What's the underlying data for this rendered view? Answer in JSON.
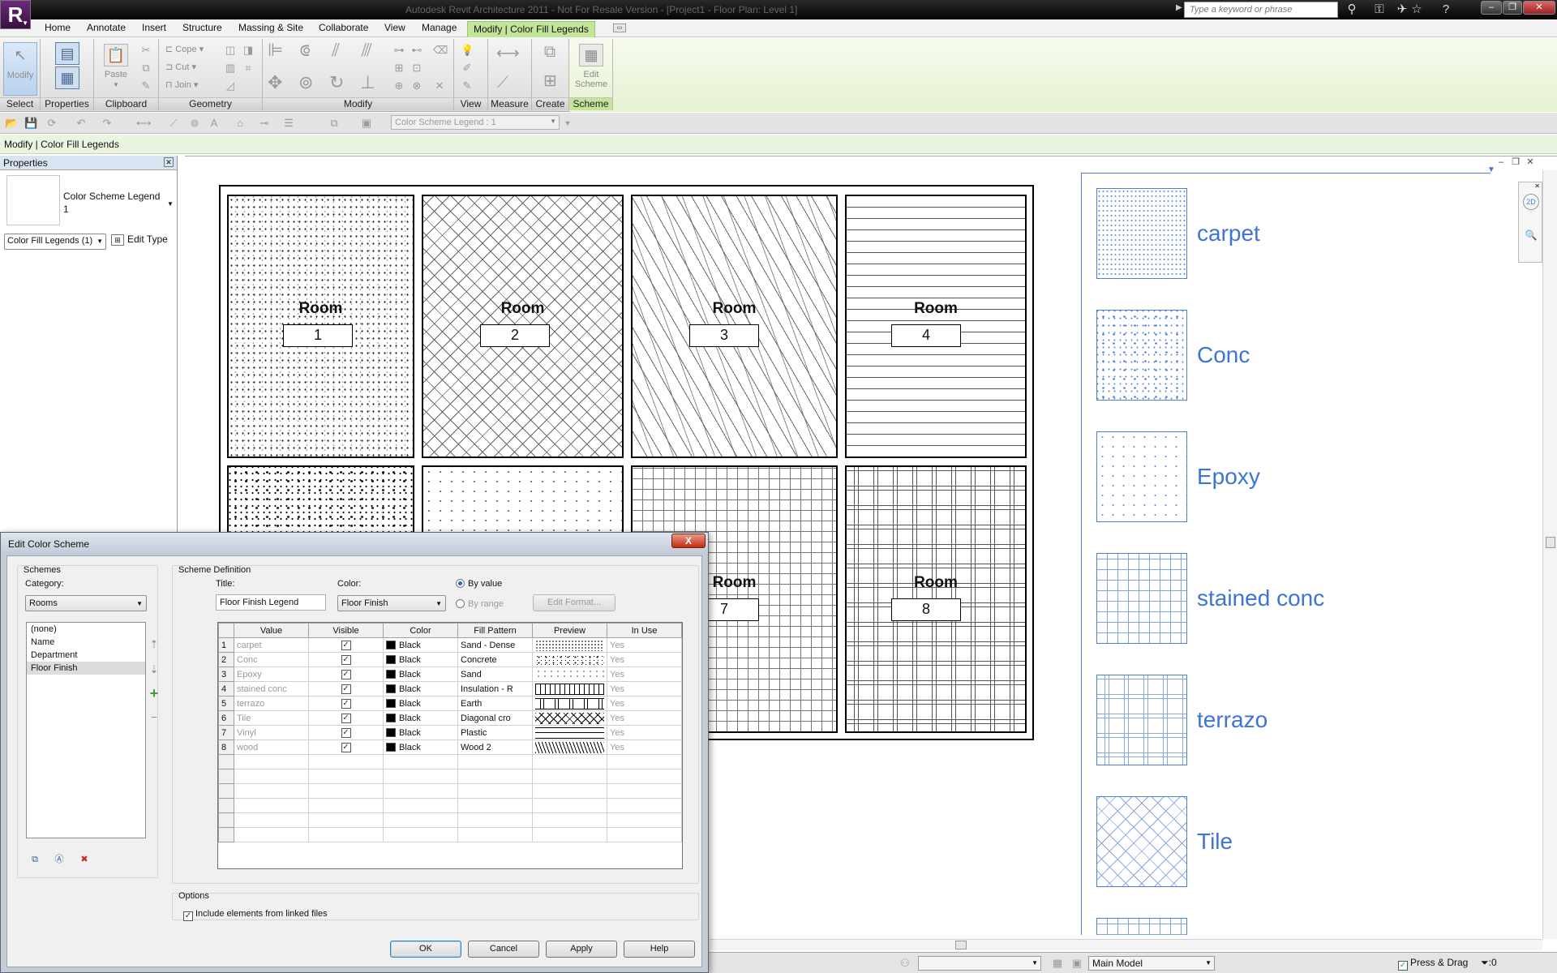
{
  "window": {
    "app_menu_letter": "R",
    "title": "Autodesk Revit Architecture 2011 - Not For Resale Version - [Project1 - Floor Plan: Level 1]",
    "search_placeholder": "Type a keyword or phrase"
  },
  "ribbon": {
    "tabs": [
      "Home",
      "Annotate",
      "Insert",
      "Structure",
      "Massing & Site",
      "Collaborate",
      "View",
      "Manage"
    ],
    "context_tab": "Modify | Color Fill Legends",
    "buttons": {
      "modify": "Modify",
      "paste": "Paste",
      "cope": "Cope",
      "cut": "Cut",
      "join": "Join",
      "edit_scheme_line1": "Edit",
      "edit_scheme_line2": "Scheme"
    },
    "panels": [
      "Select",
      "Properties",
      "Clipboard",
      "Geometry",
      "Modify",
      "View",
      "Measure",
      "Create",
      "Scheme"
    ]
  },
  "qat": {
    "type_selector": "Color Scheme Legend : 1"
  },
  "options_bar": {
    "text": "Modify | Color Fill Legends"
  },
  "properties": {
    "title": "Properties",
    "type_name_line1": "Color Scheme Legend",
    "type_name_line2": "1",
    "instance_selector": "Color Fill Legends (1)",
    "edit_type": "Edit Type"
  },
  "plan": {
    "rooms": [
      {
        "label": "Room",
        "number": "1",
        "pattern": "carpet"
      },
      {
        "label": "Room",
        "number": "2",
        "pattern": "tile"
      },
      {
        "label": "Room",
        "number": "3",
        "pattern": "sand"
      },
      {
        "label": "Room",
        "number": "4",
        "pattern": "horizontal"
      },
      {
        "label": "",
        "number": "",
        "pattern": "conc"
      },
      {
        "label": "",
        "number": "",
        "pattern": "epoxy"
      },
      {
        "label": "Room",
        "number": "7",
        "pattern": "grid"
      },
      {
        "label": "Room",
        "number": "8",
        "pattern": "terrazo"
      }
    ]
  },
  "legend": {
    "items": [
      {
        "label": "carpet"
      },
      {
        "label": "Conc"
      },
      {
        "label": "Epoxy"
      },
      {
        "label": "stained conc"
      },
      {
        "label": "terrazo"
      },
      {
        "label": "Tile"
      }
    ],
    "color": "#3d74d6"
  },
  "status_bar": {
    "workset": "",
    "model": "Main Model",
    "press_drag": "Press & Drag",
    "filter_count": ":0"
  },
  "dialog": {
    "title": "Edit Color Scheme",
    "close": "X",
    "schemes": {
      "group_label": "Schemes",
      "category_label": "Category:",
      "category_value": "Rooms",
      "list": [
        "(none)",
        "Name",
        "Department",
        "Floor Finish"
      ],
      "selected": "Floor Finish"
    },
    "definition": {
      "group_label": "Scheme Definition",
      "title_label": "Title:",
      "title_value": "Floor Finish Legend",
      "color_label": "Color:",
      "color_value": "Floor Finish",
      "by_value": "By value",
      "by_range": "By range",
      "edit_format": "Edit Format...",
      "columns": [
        "Value",
        "Visible",
        "Color",
        "Fill Pattern",
        "Preview",
        "In Use"
      ],
      "rows": [
        {
          "n": "1",
          "value": "carpet",
          "visible": true,
          "color": "Black",
          "fill": "Sand - Dense",
          "preview": "sand",
          "in_use": "Yes"
        },
        {
          "n": "2",
          "value": "Conc",
          "visible": true,
          "color": "Black",
          "fill": "Concrete",
          "preview": "conc",
          "in_use": "Yes"
        },
        {
          "n": "3",
          "value": "Epoxy",
          "visible": true,
          "color": "Black",
          "fill": "Sand",
          "preview": "sand2",
          "in_use": "Yes"
        },
        {
          "n": "4",
          "value": "stained conc",
          "visible": true,
          "color": "Black",
          "fill": "Insulation - R",
          "preview": "insul",
          "in_use": "Yes"
        },
        {
          "n": "5",
          "value": "terrazo",
          "visible": true,
          "color": "Black",
          "fill": "Earth",
          "preview": "earth",
          "in_use": "Yes"
        },
        {
          "n": "6",
          "value": "Tile",
          "visible": true,
          "color": "Black",
          "fill": "Diagonal cro",
          "preview": "diag",
          "in_use": "Yes"
        },
        {
          "n": "7",
          "value": "Vinyl",
          "visible": true,
          "color": "Black",
          "fill": "Plastic",
          "preview": "plastic",
          "in_use": "Yes"
        },
        {
          "n": "8",
          "value": "wood",
          "visible": true,
          "color": "Black",
          "fill": "Wood 2",
          "preview": "wood",
          "in_use": "Yes"
        }
      ]
    },
    "options": {
      "group_label": "Options",
      "include_linked": "Include elements from linked files",
      "include_linked_checked": true
    },
    "buttons": {
      "ok": "OK",
      "cancel": "Cancel",
      "apply": "Apply",
      "help": "Help"
    }
  }
}
